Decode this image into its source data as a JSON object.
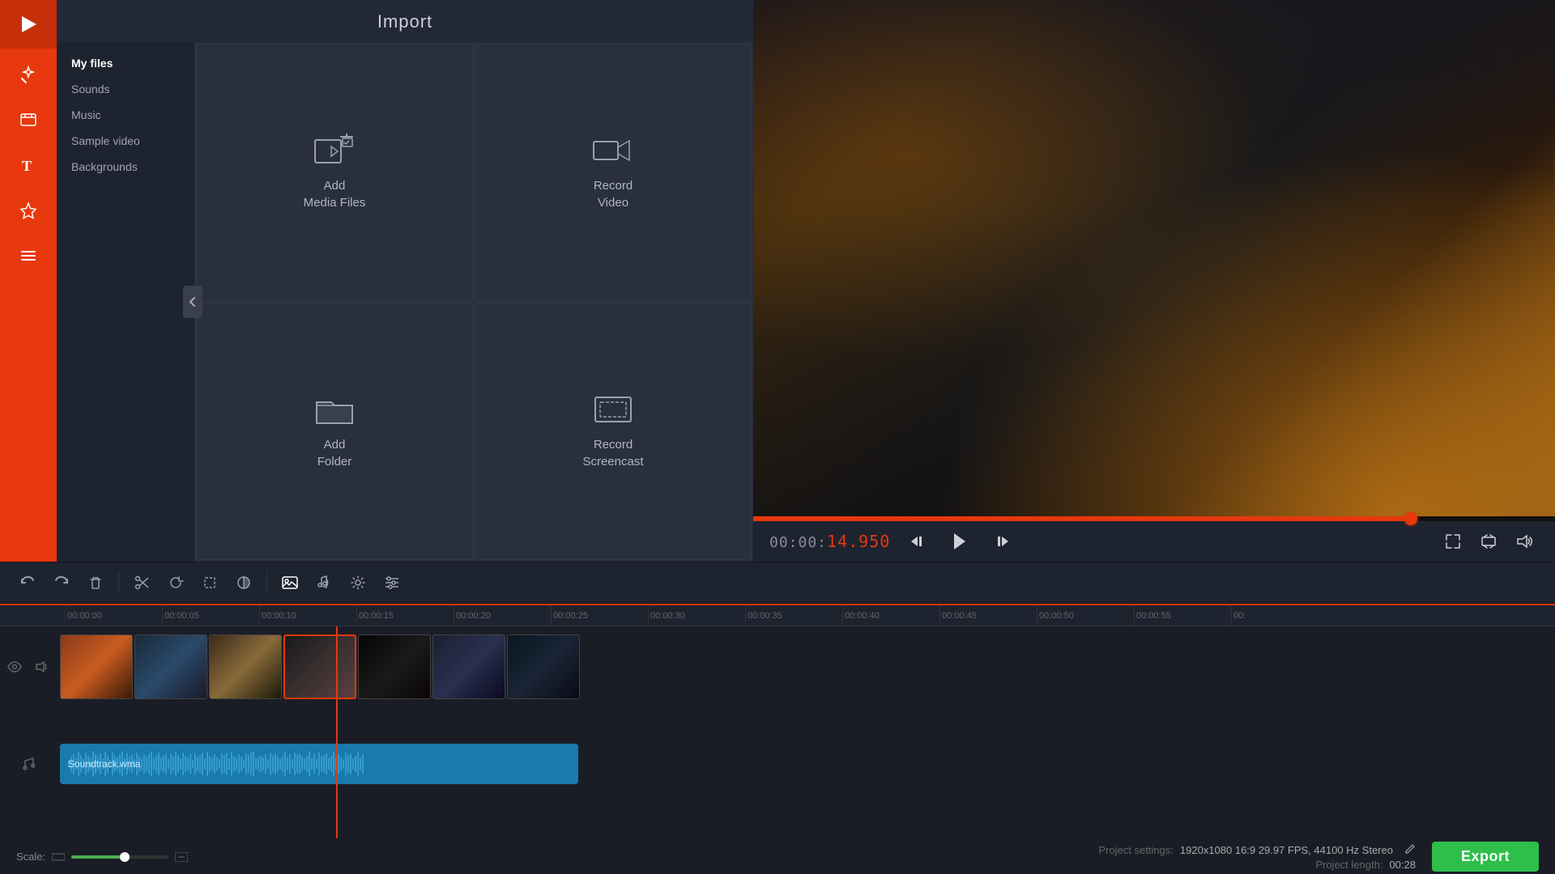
{
  "app": {
    "title": "Import"
  },
  "sidebar": {
    "tools": [
      {
        "name": "video-editor-tool",
        "icon": "▶"
      },
      {
        "name": "magic-tool",
        "icon": "✦"
      },
      {
        "name": "clip-tool",
        "icon": "⚄"
      },
      {
        "name": "text-tool",
        "icon": "T"
      },
      {
        "name": "effects-tool",
        "icon": "★"
      },
      {
        "name": "menu-tool",
        "icon": "≡"
      }
    ]
  },
  "import_nav": {
    "items": [
      {
        "label": "My files",
        "active": true
      },
      {
        "label": "Sounds"
      },
      {
        "label": "Music"
      },
      {
        "label": "Sample video"
      },
      {
        "label": "Backgrounds"
      }
    ]
  },
  "import_actions": [
    {
      "id": "add-media",
      "label": "Add\nMedia Files"
    },
    {
      "id": "record-video",
      "label": "Record\nVideo"
    },
    {
      "id": "add-folder",
      "label": "Add\nFolder"
    },
    {
      "id": "record-screencast",
      "label": "Record\nScreencast"
    }
  ],
  "toolbar": {
    "buttons": [
      {
        "name": "undo",
        "icon": "↩"
      },
      {
        "name": "redo",
        "icon": "↪"
      },
      {
        "name": "delete",
        "icon": "🗑"
      },
      {
        "name": "cut",
        "icon": "✂"
      },
      {
        "name": "rotate",
        "icon": "↻"
      },
      {
        "name": "crop",
        "icon": "⊡"
      },
      {
        "name": "color",
        "icon": "◑"
      },
      {
        "name": "image",
        "icon": "🖼"
      },
      {
        "name": "audio",
        "icon": "🎤"
      },
      {
        "name": "settings",
        "icon": "⚙"
      },
      {
        "name": "adjust",
        "icon": "⊞"
      }
    ]
  },
  "preview": {
    "time_static": "00:00:",
    "time_running": "14.950",
    "scrubber_pct": 82
  },
  "timeline": {
    "ruler_marks": [
      "00:00:00",
      "00:00:05",
      "00:00:10",
      "00:00:15",
      "00:00:20",
      "00:00:25",
      "00:00:30",
      "00:00:35",
      "00:00:40",
      "00:00:45",
      "00:00:50",
      "00:00:55",
      "00:"
    ],
    "audio_label": "Soundtrack.wma"
  },
  "bottom": {
    "scale_label": "Scale:",
    "project_settings_label": "Project settings:",
    "project_settings_value": "1920x1080 16:9 29.97 FPS, 44100 Hz Stereo",
    "project_length_label": "Project length:",
    "project_length_value": "00:28",
    "export_label": "Export"
  }
}
